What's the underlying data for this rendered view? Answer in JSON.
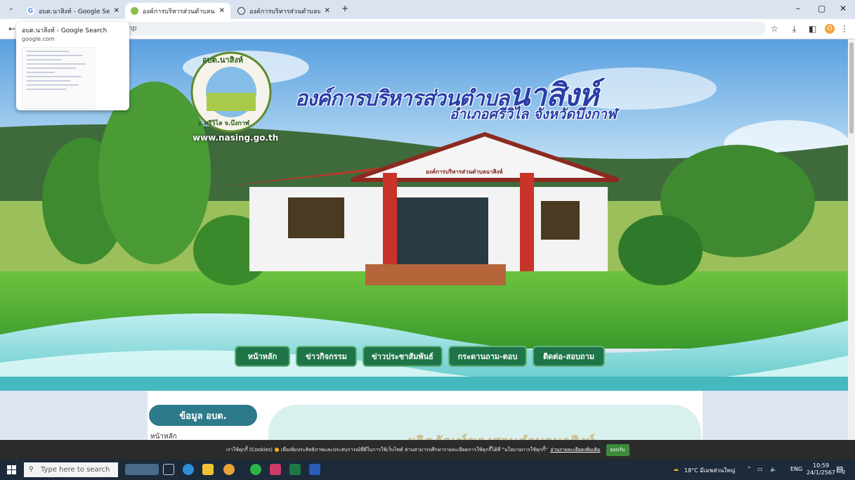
{
  "browser": {
    "tabs": [
      {
        "title": "อบต.นาสิงห์ - Google Search",
        "icon": "google-icon"
      },
      {
        "title": "องค์การบริหารส่วนตำบลนาสิงห์ อำเ...",
        "icon": "site-icon"
      },
      {
        "title": "องค์การบริหารส่วนตำบลนาสิงห์ อำเ...",
        "icon": "globe-icon"
      }
    ],
    "address_text": "hp",
    "hover_card": {
      "title": "อบต.นาสิงห์ - Google Search",
      "url": "google.com"
    },
    "profile_initial": "O",
    "new_tab": "+",
    "controls": {
      "minimize": "–",
      "maximize": "▢",
      "close": "✕"
    }
  },
  "site": {
    "logo_top": "อบต.นาสิงห์",
    "logo_bottom": "อ.ศรีวิไล จ.บึงกาฬ",
    "title_small": "องค์การบริหารส่วนตำบล",
    "title_big": "นาสิงห์",
    "subtitle": "อำเภอศรีวิไล จังหวัดบึงกาฬ",
    "url": "www.nasing.go.th",
    "building_sign": "องค์การบริหารส่วนตำบลนาสิงห์",
    "nav": [
      "หน้าหลัก",
      "ข่าวกิจกรรม",
      "ข่าวประชาสัมพันธ์",
      "กระดานถาม-ตอบ",
      "ติดต่อ-สอบถาม"
    ],
    "info_header": "ข้อมูล อบต.",
    "home_link": "หน้าหลัก",
    "watermark": "ผลิตภัณฑ์ของสวนตำบลนาสิงห์"
  },
  "cookie": {
    "prefix": "เราใช้คุกกี้ (Cookies)",
    "text": "เพื่อเพิ่มประสิทธิภาพและประสบการณ์ที่ดีในการใช้เว็บไซต์ ท่านสามารถศึกษารายละเอียดการใช้คุกกี้ได้ที่ \"นโยบายการใช้คุกกี้\"",
    "link": "อ่านรายละเอียดเพิ่มเติม",
    "accept": "ยอมรับ"
  },
  "taskbar": {
    "search_placeholder": "Type here to search",
    "weather": "18°C มีเมฆส่วนใหญ่",
    "lang": "ENG",
    "time": "10:59",
    "date": "24/1/2567",
    "notification_count": "2"
  },
  "colors": {
    "nav_green": "#1f7448",
    "title_blue": "#2a3fa8",
    "info_teal": "#2c7a8a"
  }
}
